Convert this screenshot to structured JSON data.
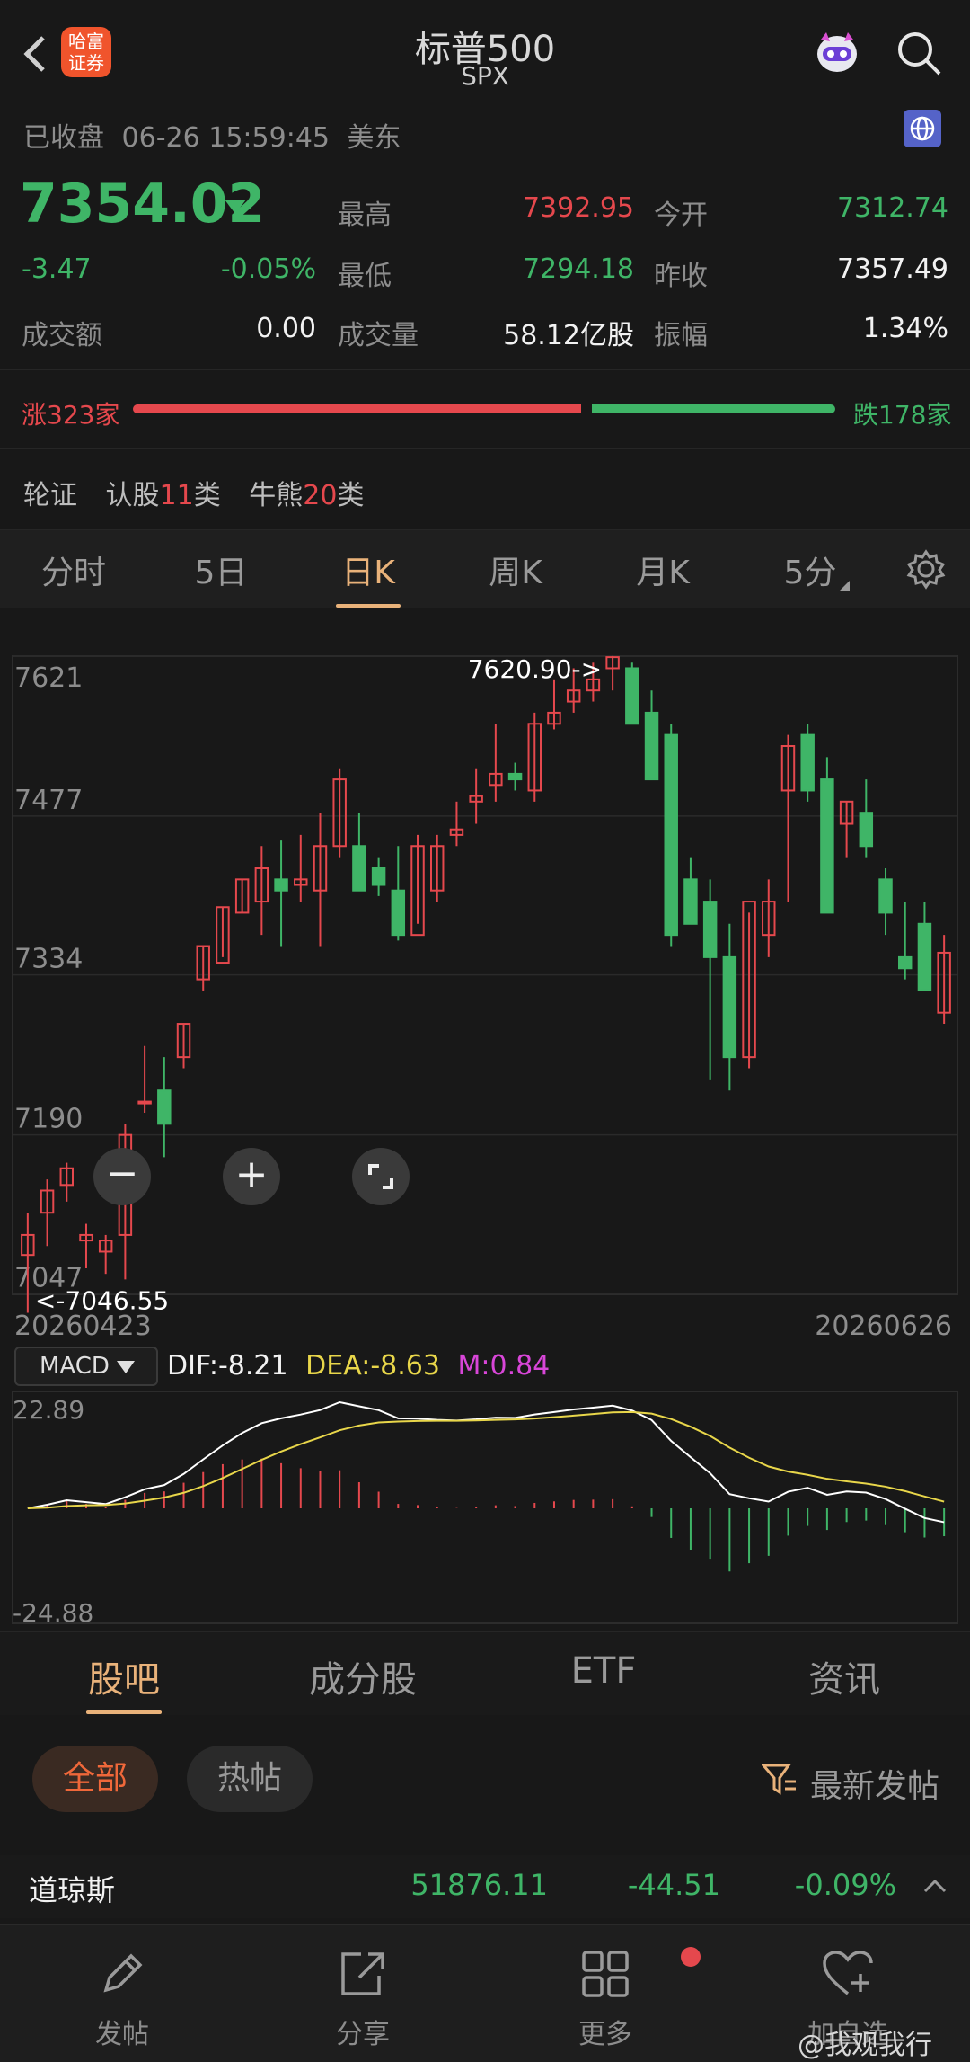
{
  "header": {
    "title": "标普500",
    "subtitle": "SPX",
    "broker_logo": "哈富证券",
    "search_icon": "search-icon",
    "mascot_icon": "robot-icon"
  },
  "status": {
    "state": "已收盘",
    "datetime": "06-26 15:59:45",
    "market": "美东"
  },
  "quote": {
    "price": "7354.02",
    "change": "-3.47",
    "change_pct": "-0.05%",
    "turnover_label": "成交额",
    "turnover": "0.00",
    "high_label": "最高",
    "high": "7392.95",
    "low_label": "最低",
    "low": "7294.18",
    "volume_label": "成交量",
    "volume": "58.12亿股",
    "open_label": "今开",
    "open": "7312.74",
    "prev_close_label": "昨收",
    "prev_close": "7357.49",
    "amplitude_label": "振幅",
    "amplitude": "1.34%"
  },
  "breadth": {
    "up": "涨323家",
    "down": "跌178家",
    "up_ratio": 0.646
  },
  "warrants": {
    "label": "轮证",
    "call_pre": "认股",
    "call_num": "11",
    "call_post": "类",
    "bull_pre": "牛熊",
    "bull_num": "20",
    "bull_post": "类"
  },
  "period_tabs": [
    "分时",
    "5日",
    "日K",
    "周K",
    "月K",
    "5分"
  ],
  "active_period": "日K",
  "chart_controls": {
    "zoom_out": "−",
    "zoom_in": "+",
    "fullscreen": "fullscreen-icon",
    "settings": "gear-icon"
  },
  "chart_data": {
    "type": "candlestick",
    "y_ticks": [
      "7621",
      "7477",
      "7334",
      "7190",
      "7047"
    ],
    "ylim": [
      7046.55,
      7620.9
    ],
    "max_label": "7620.90->",
    "min_label": "<-7046.55",
    "start_date": "20260423",
    "end_date": "20260626",
    "candles": [
      [
        7082,
        7120,
        7030,
        7100
      ],
      [
        7120,
        7150,
        7090,
        7140
      ],
      [
        7145,
        7165,
        7130,
        7160
      ],
      [
        7095,
        7110,
        7070,
        7100
      ],
      [
        7085,
        7100,
        7065,
        7095
      ],
      [
        7100,
        7200,
        7060,
        7190
      ],
      [
        7220,
        7270,
        7210,
        7220
      ],
      [
        7230,
        7260,
        7170,
        7200
      ],
      [
        7260,
        7290,
        7250,
        7290
      ],
      [
        7330,
        7360,
        7320,
        7360
      ],
      [
        7345,
        7395,
        7350,
        7395
      ],
      [
        7390,
        7420,
        7390,
        7420
      ],
      [
        7400,
        7450,
        7370,
        7430
      ],
      [
        7420,
        7455,
        7360,
        7410
      ],
      [
        7415,
        7460,
        7400,
        7420
      ],
      [
        7410,
        7480,
        7360,
        7450
      ],
      [
        7450,
        7520,
        7440,
        7510
      ],
      [
        7450,
        7480,
        7430,
        7410
      ],
      [
        7430,
        7440,
        7405,
        7415
      ],
      [
        7410,
        7450,
        7365,
        7370
      ],
      [
        7370,
        7460,
        7380,
        7450
      ],
      [
        7410,
        7460,
        7400,
        7450
      ],
      [
        7460,
        7490,
        7450,
        7465
      ],
      [
        7490,
        7520,
        7470,
        7495
      ],
      [
        7505,
        7560,
        7490,
        7515
      ],
      [
        7515,
        7525,
        7500,
        7510
      ],
      [
        7500,
        7570,
        7490,
        7560
      ],
      [
        7560,
        7600,
        7555,
        7570
      ],
      [
        7580,
        7610,
        7570,
        7590
      ],
      [
        7590,
        7615,
        7580,
        7600
      ],
      [
        7610,
        7621,
        7590,
        7620
      ],
      [
        7610,
        7615,
        7560,
        7560
      ],
      [
        7570,
        7590,
        7510,
        7510
      ],
      [
        7550,
        7560,
        7360,
        7370
      ],
      [
        7420,
        7440,
        7400,
        7380
      ],
      [
        7400,
        7420,
        7240,
        7350
      ],
      [
        7350,
        7380,
        7230,
        7260
      ],
      [
        7260,
        7390,
        7250,
        7400
      ],
      [
        7370,
        7420,
        7350,
        7400
      ],
      [
        7500,
        7550,
        7400,
        7540
      ],
      [
        7550,
        7560,
        7490,
        7500
      ],
      [
        7510,
        7530,
        7460,
        7390
      ],
      [
        7470,
        7490,
        7440,
        7490
      ],
      [
        7480,
        7510,
        7440,
        7450
      ],
      [
        7420,
        7430,
        7370,
        7390
      ],
      [
        7350,
        7400,
        7330,
        7340
      ],
      [
        7380,
        7400,
        7320,
        7320
      ],
      [
        7300,
        7370,
        7290,
        7354
      ]
    ]
  },
  "macd": {
    "label": "MACD",
    "dif": "DIF:-8.21",
    "dea": "DEA:-8.63",
    "m": "M:0.84",
    "top": "22.89",
    "bottom": "-24.88"
  },
  "section_tabs": [
    "股吧",
    "成分股",
    "ETF",
    "资讯"
  ],
  "active_section": "股吧",
  "filters": {
    "all": "全部",
    "hot": "热帖",
    "sort": "最新发帖"
  },
  "ticker": {
    "name": "道琼斯",
    "price": "51876.11",
    "change": "-44.51",
    "pct": "-0.09%"
  },
  "bottom_nav": [
    {
      "label": "发帖",
      "icon": "pen-icon"
    },
    {
      "label": "分享",
      "icon": "share-icon"
    },
    {
      "label": "更多",
      "icon": "grid-icon"
    },
    {
      "label": "加自选",
      "icon": "heart-plus-icon"
    }
  ],
  "watermark": "@我观我行",
  "colors": {
    "up": "#e5484d",
    "down": "#3fb567",
    "accent": "#e9b27a",
    "bg": "#181818"
  }
}
